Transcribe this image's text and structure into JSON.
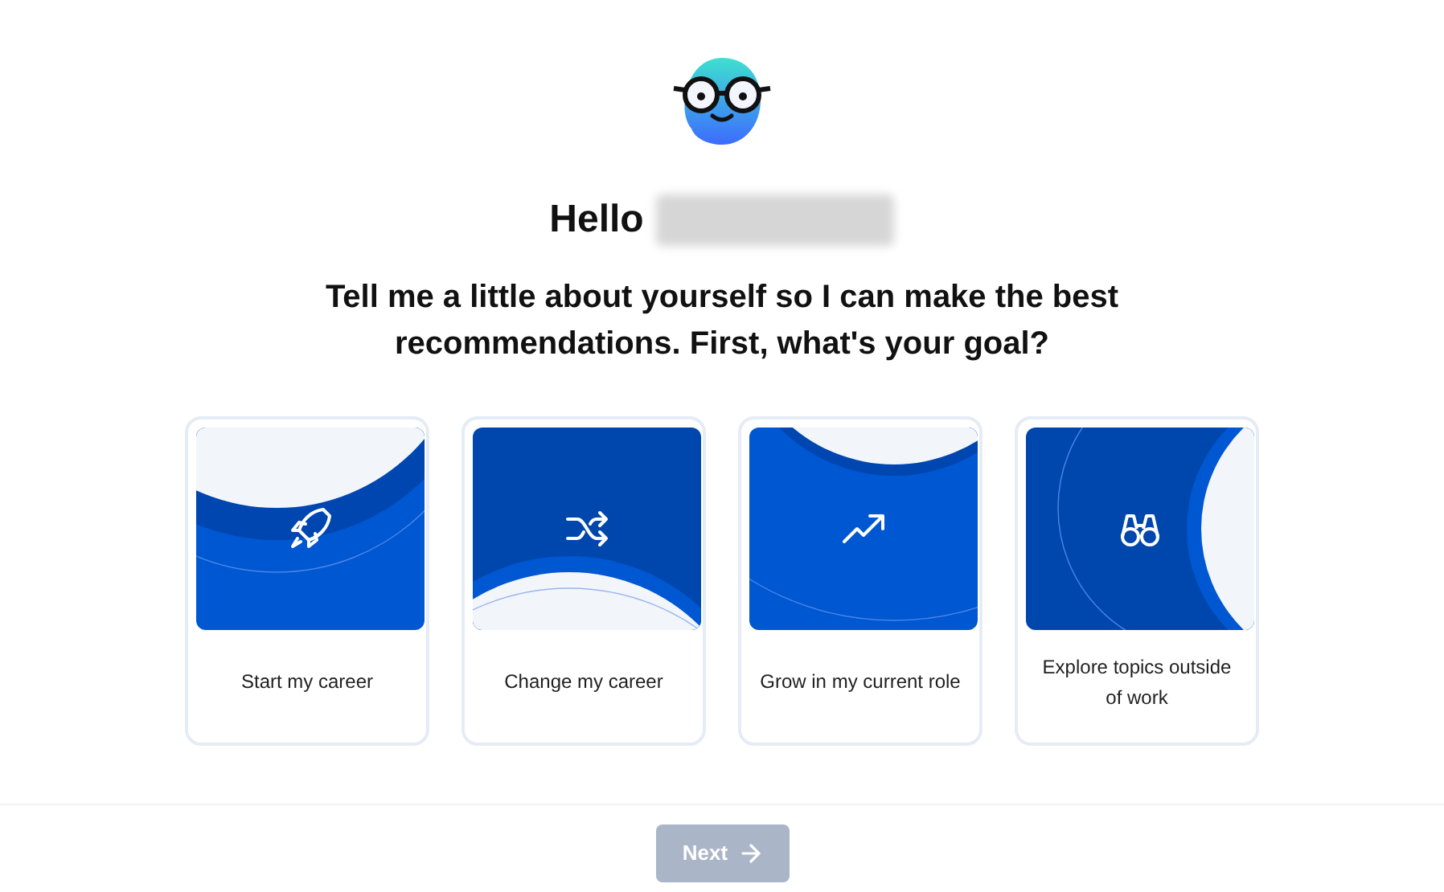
{
  "greeting": "Hello",
  "question": "Tell me a little about yourself so I can make the best recommendations. First, what's your goal?",
  "goals": [
    {
      "label": "Start my career",
      "kind": "rocket",
      "selected": false
    },
    {
      "label": "Change my career",
      "kind": "shuffle",
      "selected": false
    },
    {
      "label": "Grow in my current role",
      "kind": "trend",
      "selected": false
    },
    {
      "label": "Explore topics outside of work",
      "kind": "binoculars",
      "selected": false
    }
  ],
  "next_button": {
    "label": "Next",
    "disabled": true
  }
}
